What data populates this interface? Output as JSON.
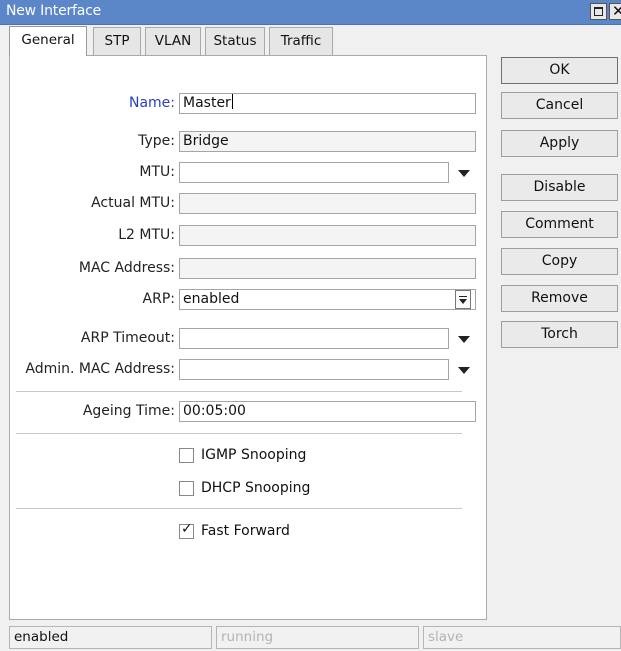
{
  "window": {
    "title": "New Interface"
  },
  "tabs": [
    {
      "label": "General",
      "active": true
    },
    {
      "label": "STP",
      "active": false
    },
    {
      "label": "VLAN",
      "active": false
    },
    {
      "label": "Status",
      "active": false
    },
    {
      "label": "Traffic",
      "active": false
    }
  ],
  "form": {
    "name": {
      "label": "Name:",
      "value": "Master"
    },
    "type": {
      "label": "Type:",
      "value": "Bridge"
    },
    "mtu": {
      "label": "MTU:",
      "value": ""
    },
    "actual_mtu": {
      "label": "Actual MTU:",
      "value": ""
    },
    "l2_mtu": {
      "label": "L2 MTU:",
      "value": ""
    },
    "mac_address": {
      "label": "MAC Address:",
      "value": ""
    },
    "arp": {
      "label": "ARP:",
      "value": "enabled"
    },
    "arp_timeout": {
      "label": "ARP Timeout:",
      "value": ""
    },
    "admin_mac": {
      "label": "Admin. MAC Address:",
      "value": ""
    },
    "ageing_time": {
      "label": "Ageing Time:",
      "value": "00:05:00"
    }
  },
  "checkboxes": {
    "igmp_snooping": {
      "label": "IGMP Snooping",
      "checked": false
    },
    "dhcp_snooping": {
      "label": "DHCP Snooping",
      "checked": false
    },
    "fast_forward": {
      "label": "Fast Forward",
      "checked": true
    }
  },
  "buttons": {
    "ok": "OK",
    "cancel": "Cancel",
    "apply": "Apply",
    "disable": "Disable",
    "comment": "Comment",
    "copy": "Copy",
    "remove": "Remove",
    "torch": "Torch"
  },
  "status": {
    "state": "enabled",
    "running": "running",
    "slave": "slave"
  },
  "icons": {
    "maximize": "maximize-icon",
    "close": "close-icon",
    "dropdown": "chevron-down-icon",
    "spin": "spin-down-icon",
    "check": "checkmark-icon"
  },
  "colors": {
    "titlebar": "#5b86c8",
    "highlight_label": "#2a3fbf"
  }
}
